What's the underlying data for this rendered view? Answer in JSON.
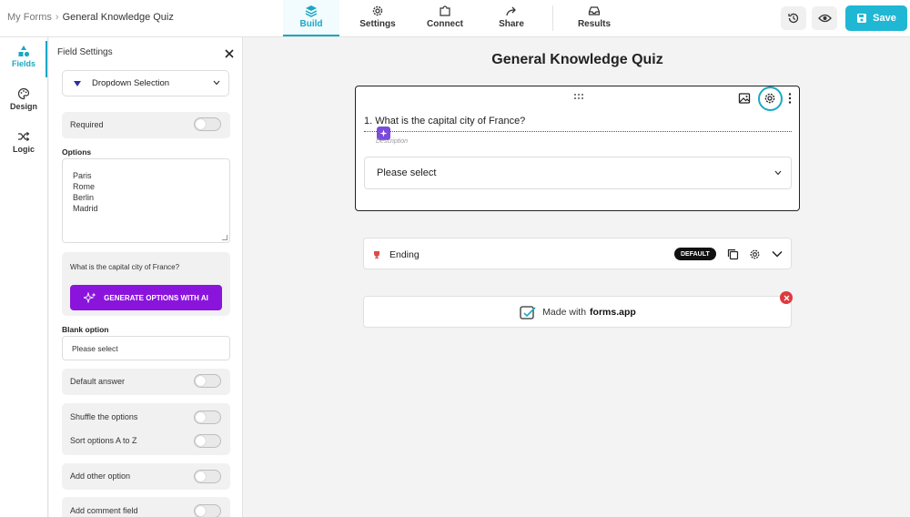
{
  "breadcrumb": {
    "root": "My Forms",
    "separator": "›",
    "current": "General Knowledge Quiz"
  },
  "nav": [
    {
      "label": "Build",
      "icon": "layers-icon",
      "active": true
    },
    {
      "label": "Settings",
      "icon": "gear-icon"
    },
    {
      "label": "Connect",
      "icon": "puzzle-icon"
    },
    {
      "label": "Share",
      "icon": "share-icon"
    },
    {
      "label": "Results",
      "icon": "inbox-icon"
    }
  ],
  "toolbar": {
    "save_label": "Save"
  },
  "rail": [
    {
      "label": "Fields",
      "icon": "shapes-icon",
      "active": true
    },
    {
      "label": "Design",
      "icon": "palette-icon"
    },
    {
      "label": "Logic",
      "icon": "shuffle-icon"
    }
  ],
  "panel": {
    "title": "Field Settings",
    "field_type": "Dropdown Selection",
    "required_label": "Required",
    "options_label": "Options",
    "options_text": "Paris\nRome\nBerlin\nMadrid",
    "ai_question": "What is the capital city of France?",
    "ai_button": "GENERATE OPTIONS WITH AI",
    "blank_option_label": "Blank option",
    "blank_option_value": "Please select",
    "default_answer_label": "Default answer",
    "shuffle_label": "Shuffle the options",
    "sort_label": "Sort options A to Z",
    "add_other_label": "Add other option",
    "add_comment_label": "Add comment field"
  },
  "form": {
    "title": "General Knowledge Quiz",
    "question": "1. What is the capital city of France?",
    "description_placeholder": "Description",
    "dropdown_value": "Please select",
    "ending_label": "Ending",
    "ending_badge": "DEFAULT",
    "made_with_prefix": "Made with",
    "made_with_brand": "forms.app"
  },
  "colors": {
    "accent": "#1aa7c4",
    "save": "#1fb7d4",
    "ai_button": "#8a14dc",
    "close": "#e0393e"
  }
}
